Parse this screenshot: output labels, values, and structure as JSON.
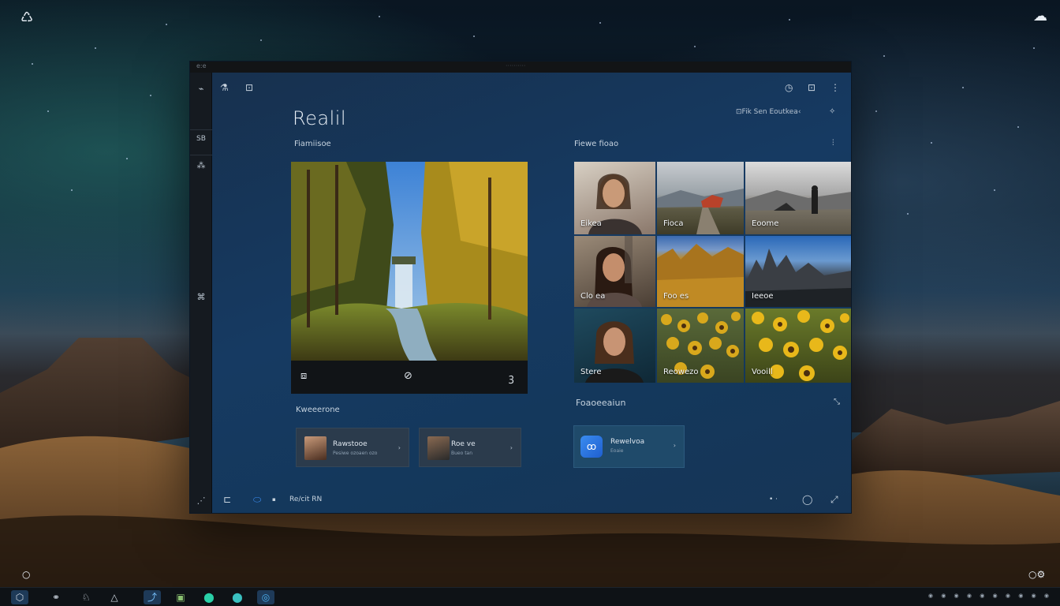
{
  "desktop": {
    "top_left_icon": "♺",
    "top_right_icon": "☁",
    "bottom_left_icon": "○",
    "bottom_right_icon": "○⚙"
  },
  "window": {
    "title_left": "e:e",
    "title_center": "··········",
    "rail_icons": [
      "⌁",
      "SB",
      "⁂",
      "⌘",
      "⋰"
    ],
    "top_icons_left": [
      "⚗",
      "⊡"
    ],
    "top_icons_right": [
      "◷",
      "⊡",
      "⋮"
    ],
    "app_title": "Realil",
    "right_link": "⊡Fik Sen Eoutkea‹",
    "right_link_icon": "✧",
    "featured_label": "Fiamiisoe",
    "featured_bar": {
      "left": "⧈",
      "center": "⊘",
      "right": "ꝫ"
    },
    "grid_label": "Fiewe fioao",
    "grid_label_icon": "⫶",
    "grid_tiles": [
      {
        "caption": "Eikea"
      },
      {
        "caption": "Fioca"
      },
      {
        "caption": "Eoome"
      },
      {
        "caption": "Clo ea"
      },
      {
        "caption": "Foo es"
      },
      {
        "caption": "Ieeoe"
      },
      {
        "caption": "Stere"
      },
      {
        "caption": "Reowezo"
      },
      {
        "caption": "Vooill"
      }
    ],
    "left_section_label": "Kweeerone",
    "right_section_label": "Foaoeeaiun",
    "right_section_icon": "⤡",
    "cards": [
      {
        "title": "Rawstooe",
        "sub": "Pesiwe ozoaen ozo",
        "chev": "›"
      },
      {
        "title": "Roe ve",
        "sub": "Bueo tan",
        "chev": "›"
      },
      {
        "title": "Rewelvoa",
        "sub": "Eoaie",
        "chev": "›",
        "app_icon": "ꝏ"
      }
    ],
    "bottom_bar": {
      "left_icon": "⊏",
      "app_icon": "⬭",
      "app_dot": "▪",
      "text": "Re/cit RN",
      "dots": "• ·",
      "circle": "◯",
      "right_icon": "⤢"
    }
  },
  "taskbar": {
    "items": [
      "⬡",
      "⚭",
      "♘",
      "△",
      "⤴",
      "▣",
      "⬤",
      "⬤",
      "◎"
    ],
    "tray": "◉ ◉ ◉ ◉ ◉ ◉ ◉ ◉ ◉ ◉"
  },
  "colors": {
    "accent": "#3a8cf0",
    "window_bg": "#163a62",
    "rail_bg": "#151a20",
    "taskbar_bg": "#0e1216"
  }
}
